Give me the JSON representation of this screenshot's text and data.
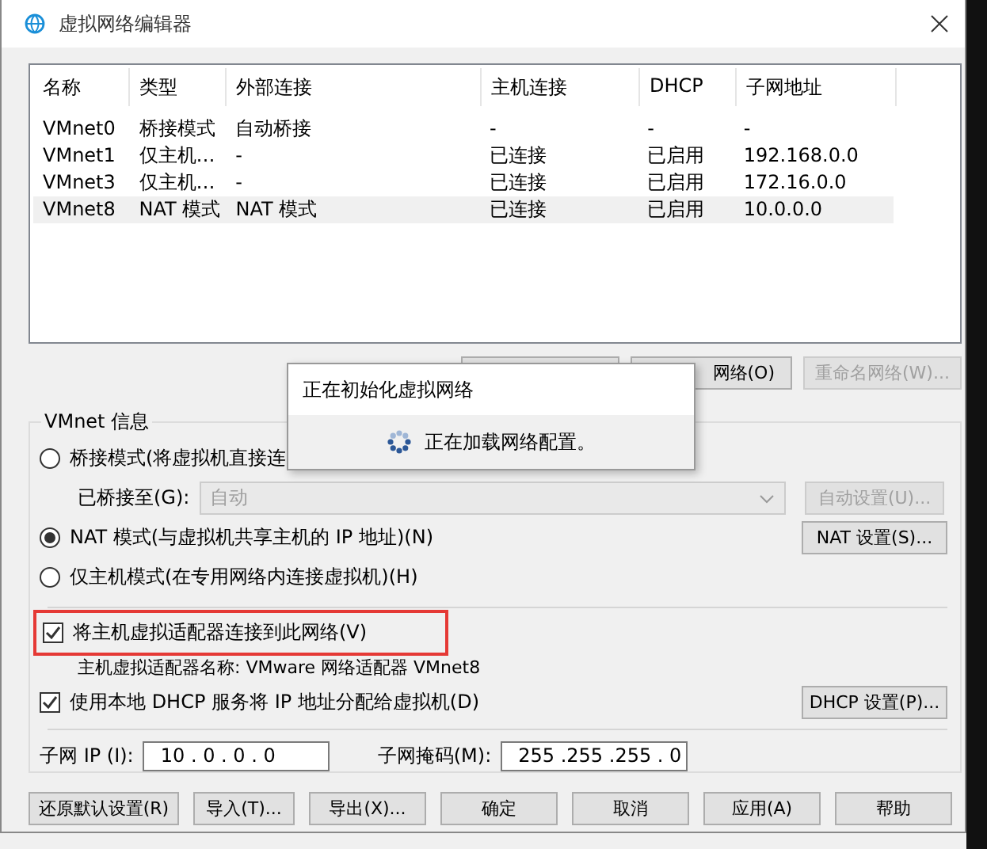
{
  "window": {
    "title": "虚拟网络编辑器"
  },
  "table": {
    "columns": [
      "名称",
      "类型",
      "外部连接",
      "主机连接",
      "DHCP",
      "子网地址"
    ],
    "rows": [
      {
        "cells": [
          "VMnet0",
          "桥接模式",
          "自动桥接",
          "-",
          "-",
          "-"
        ],
        "selected": false
      },
      {
        "cells": [
          "VMnet1",
          "仅主机…",
          "-",
          "已连接",
          "已启用",
          "192.168.0.0"
        ],
        "selected": false
      },
      {
        "cells": [
          "VMnet3",
          "仅主机…",
          "-",
          "已连接",
          "已启用",
          "172.16.0.0"
        ],
        "selected": false
      },
      {
        "cells": [
          "VMnet8",
          "NAT 模式",
          "NAT 模式",
          "已连接",
          "已启用",
          "10.0.0.0"
        ],
        "selected": true
      }
    ]
  },
  "network_buttons": [
    {
      "kind": "covered",
      "disabled": false
    },
    {
      "kind": "labeled",
      "label": "网络(O)",
      "disabled": false
    },
    {
      "kind": "labeled",
      "label": "重命名网络(W)...",
      "disabled": true
    }
  ],
  "vmnet_info": {
    "title": "VMnet 信息",
    "modes": [
      {
        "kind": "bridged",
        "label": "桥接模式(将虚拟机直接连",
        "selected": false
      },
      {
        "kind": "nat",
        "label": "NAT 模式(与虚拟机共享主机的 IP 地址)(N)",
        "selected": true
      },
      {
        "kind": "host_only",
        "label": "仅主机模式(在专用网络内连接虚拟机)(H)",
        "selected": false
      }
    ],
    "bridged_to": {
      "label": "已桥接至(G):",
      "value": "自动",
      "disabled": true
    },
    "auto_settings_button": {
      "label": "自动设置(U)...",
      "disabled": true
    },
    "nat_settings_button": "NAT 设置(S)...",
    "connect_adapter": {
      "label": "将主机虚拟适配器连接到此网络(V)",
      "checked": true,
      "highlighted": true
    },
    "adapter_name": "主机虚拟适配器名称: VMware 网络适配器 VMnet8",
    "use_dhcp": {
      "label": "使用本地 DHCP 服务将 IP 地址分配给虚拟机(D)",
      "checked": true
    },
    "dhcp_settings_button": "DHCP 设置(P)...",
    "subnet_ip": {
      "label": "子网 IP (I):",
      "value": "10 . 0 . 0 . 0"
    },
    "subnet_mask": {
      "label": "子网掩码(M):",
      "value": "255 .255 .255 . 0"
    }
  },
  "footer_buttons": [
    "还原默认设置(R)",
    "导入(T)...",
    "导出(X)...",
    "确定",
    "取消",
    "应用(A)",
    "帮助"
  ],
  "progress_dialog": {
    "title": "正在初始化虚拟网络",
    "message": "正在加载网络配置。"
  }
}
